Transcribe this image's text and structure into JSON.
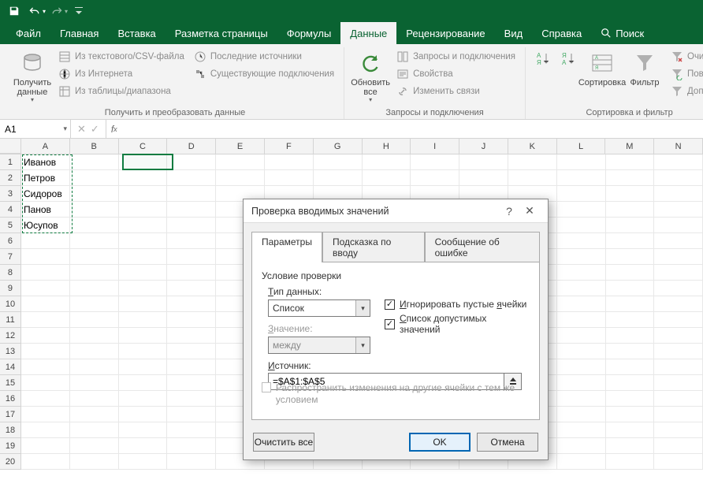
{
  "qat": {
    "save": "save",
    "undo": "undo",
    "redo": "redo"
  },
  "tabs": {
    "file": "Файл",
    "home": "Главная",
    "insert": "Вставка",
    "pagelayout": "Разметка страницы",
    "formulas": "Формулы",
    "data": "Данные",
    "review": "Рецензирование",
    "view": "Вид",
    "help": "Справка",
    "search": "Поиск"
  },
  "ribbon": {
    "getdata": {
      "big": "Получить\nданные",
      "csv": "Из текстового/CSV-файла",
      "web": "Из Интернета",
      "range": "Из таблицы/диапазона",
      "recent": "Последние источники",
      "existing": "Существующие подключения",
      "group": "Получить и преобразовать данные"
    },
    "refresh": {
      "big": "Обновить\nвсе",
      "queries": "Запросы и подключения",
      "props": "Свойства",
      "editlinks": "Изменить связи",
      "group": "Запросы и подключения"
    },
    "sort": {
      "sort": "Сортировка",
      "filter": "Фильтр",
      "clear": "Очистит",
      "reapply": "Повтори",
      "advanced": "Дополни",
      "group": "Сортировка и фильтр"
    }
  },
  "namebox": "A1",
  "columns": [
    "A",
    "B",
    "C",
    "D",
    "E",
    "F",
    "G",
    "H",
    "I",
    "J",
    "K",
    "L",
    "M",
    "N"
  ],
  "rownums": [
    "1",
    "2",
    "3",
    "4",
    "5",
    "6",
    "7",
    "8",
    "9",
    "10",
    "11",
    "12",
    "13",
    "14",
    "15",
    "16",
    "17",
    "18",
    "19",
    "20"
  ],
  "cells": {
    "A1": "Иванов",
    "A2": "Петров",
    "A3": "Сидоров",
    "A4": "Панов",
    "A5": "Юсупов"
  },
  "dialog": {
    "title": "Проверка вводимых значений",
    "help": "?",
    "tabs": {
      "params": "Параметры",
      "input": "Подсказка по вводу",
      "error": "Сообщение об ошибке"
    },
    "legend": "Условие проверки",
    "typelabel": "Тип данных:",
    "typevalue": "Список",
    "ignoreblank": "Игнорировать пустые ячейки",
    "incell": "Список допустимых значений",
    "valuelabel": "Значение:",
    "valuevalue": "между",
    "sourcelabel": "Источник:",
    "sourcevalue": "=$A$1:$A$5",
    "applyall": "Распространить изменения на другие ячейки с тем же условием",
    "clearall": "Очистить все",
    "ok": "OK",
    "cancel": "Отмена"
  }
}
